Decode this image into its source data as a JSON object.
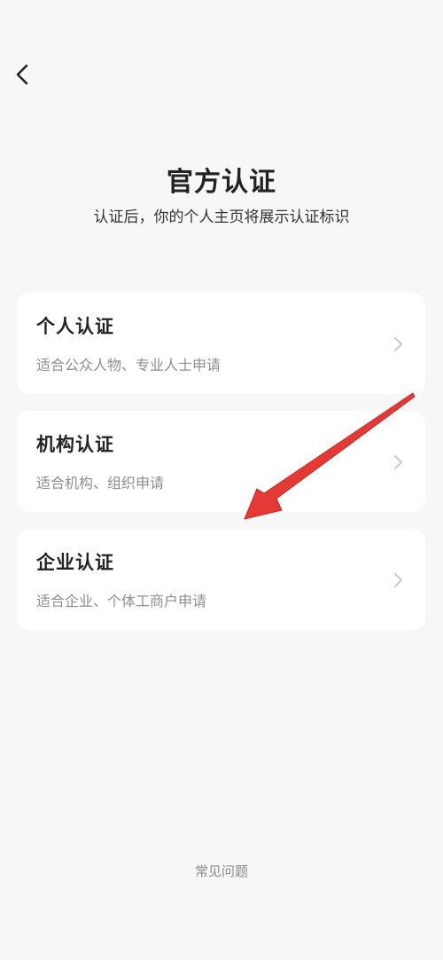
{
  "nav": {
    "back_icon": "chevron-left-icon"
  },
  "header": {
    "title": "官方认证",
    "subtitle": "认证后，你的个人主页将展示认证标识"
  },
  "options": [
    {
      "title": "个人认证",
      "description": "适合公众人物、专业人士申请",
      "icon": "chevron-right-icon"
    },
    {
      "title": "机构认证",
      "description": "适合机构、组织申请",
      "icon": "chevron-right-icon"
    },
    {
      "title": "企业认证",
      "description": "适合企业、个体工商户申请",
      "icon": "chevron-right-icon"
    }
  ],
  "footer": {
    "faq_label": "常见问题"
  },
  "colors": {
    "background": "#f7f7f7",
    "card": "#ffffff",
    "annotation": "#e53935"
  }
}
